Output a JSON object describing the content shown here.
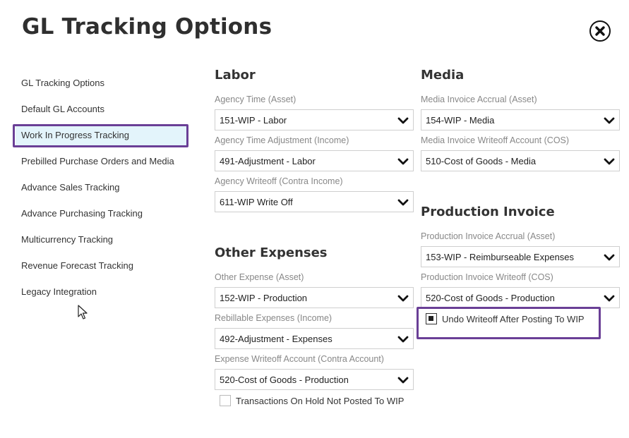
{
  "header": {
    "title": "GL Tracking Options"
  },
  "sidebar": {
    "items": [
      {
        "label": "GL Tracking Options"
      },
      {
        "label": "Default GL Accounts"
      },
      {
        "label": "Work In Progress Tracking"
      },
      {
        "label": "Prebilled Purchase Orders and Media"
      },
      {
        "label": "Advance Sales Tracking"
      },
      {
        "label": "Advance Purchasing Tracking"
      },
      {
        "label": "Multicurrency Tracking"
      },
      {
        "label": "Revenue Forecast Tracking"
      },
      {
        "label": "Legacy Integration"
      }
    ],
    "selected_index": 2
  },
  "labor": {
    "title": "Labor",
    "fields": [
      {
        "label": "Agency Time (Asset)",
        "value": "151-WIP - Labor"
      },
      {
        "label": "Agency Time Adjustment (Income)",
        "value": "491-Adjustment - Labor"
      },
      {
        "label": "Agency Writeoff (Contra Income)",
        "value": "611-WIP Write Off"
      }
    ]
  },
  "other_expenses": {
    "title": "Other Expenses",
    "fields": [
      {
        "label": "Other Expense (Asset)",
        "value": "152-WIP - Production"
      },
      {
        "label": "Rebillable Expenses (Income)",
        "value": "492-Adjustment - Expenses"
      },
      {
        "label": "Expense Writeoff Account (Contra Account)",
        "value": "520-Cost of Goods - Production"
      }
    ],
    "checkbox": {
      "label": "Transactions On Hold Not Posted To WIP",
      "checked": false
    }
  },
  "media": {
    "title": "Media",
    "fields": [
      {
        "label": "Media Invoice Accrual (Asset)",
        "value": "154-WIP - Media"
      },
      {
        "label": "Media Invoice Writeoff Account (COS)",
        "value": "510-Cost of Goods - Media"
      }
    ]
  },
  "production_invoice": {
    "title": "Production Invoice",
    "fields": [
      {
        "label": "Production Invoice Accrual (Asset)",
        "value": "153-WIP - Reimburseable Expenses"
      },
      {
        "label": "Production Invoice Writeoff (COS)",
        "value": "520-Cost of Goods - Production"
      }
    ],
    "checkbox": {
      "label": "Undo Writeoff After Posting To WIP",
      "checked": true
    }
  },
  "colors": {
    "highlight_frame": "#6a3f96",
    "selected_bg": "#e3f4fb"
  },
  "icons": {
    "close": "close-circle-icon",
    "dropdown": "chevron-down-icon",
    "pointer": "mouse-cursor-icon"
  }
}
